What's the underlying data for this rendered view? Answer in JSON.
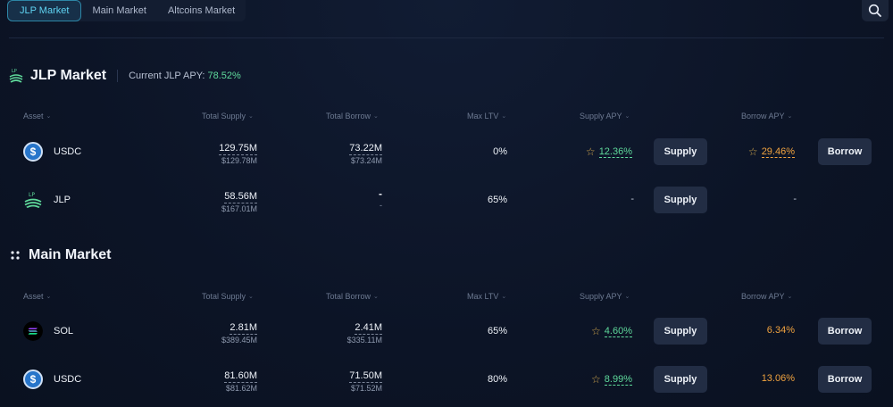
{
  "tabs": [
    {
      "label": "JLP Market",
      "active": true
    },
    {
      "label": "Main Market",
      "active": false
    },
    {
      "label": "Altcoins Market",
      "active": false
    }
  ],
  "search_icon": "search-icon",
  "colors": {
    "accent": "#5fd3f2",
    "green": "#5fd99b",
    "orange": "#f0a23f",
    "background": "#0c1426",
    "button": "#222d44"
  },
  "headers": {
    "asset": "Asset",
    "total_supply": "Total Supply",
    "total_borrow": "Total Borrow",
    "max_ltv": "Max LTV",
    "supply_apy": "Supply APY",
    "borrow_apy": "Borrow APY"
  },
  "jlp_market": {
    "title": "JLP Market",
    "apy_label": "Current JLP APY:",
    "apy_value": "78.52%",
    "icon": "jlp-logo-icon",
    "rows": [
      {
        "asset": "USDC",
        "icon": "usdc-icon",
        "supply": "129.75M",
        "supply_usd": "$129.78M",
        "borrow": "73.22M",
        "borrow_usd": "$73.24M",
        "ltv": "0%",
        "supply_apy": "12.36%",
        "borrow_apy": "29.46%",
        "supply_btn": "Supply",
        "borrow_btn": "Borrow"
      },
      {
        "asset": "JLP",
        "icon": "jlp-icon",
        "supply": "58.56M",
        "supply_usd": "$167.01M",
        "borrow": "-",
        "borrow_usd": "-",
        "ltv": "65%",
        "supply_apy": "-",
        "borrow_apy": "-",
        "supply_btn": "Supply"
      }
    ]
  },
  "main_market": {
    "title": "Main Market",
    "icon": "grid-dots-icon",
    "rows": [
      {
        "asset": "SOL",
        "icon": "sol-icon",
        "supply": "2.81M",
        "supply_usd": "$389.45M",
        "borrow": "2.41M",
        "borrow_usd": "$335.11M",
        "ltv": "65%",
        "supply_apy": "4.60%",
        "borrow_apy": "6.34%",
        "supply_btn": "Supply",
        "borrow_btn": "Borrow"
      },
      {
        "asset": "USDC",
        "icon": "usdc-icon",
        "supply": "81.60M",
        "supply_usd": "$81.62M",
        "borrow": "71.50M",
        "borrow_usd": "$71.52M",
        "ltv": "80%",
        "supply_apy": "8.99%",
        "borrow_apy": "13.06%",
        "supply_btn": "Supply",
        "borrow_btn": "Borrow"
      }
    ]
  }
}
